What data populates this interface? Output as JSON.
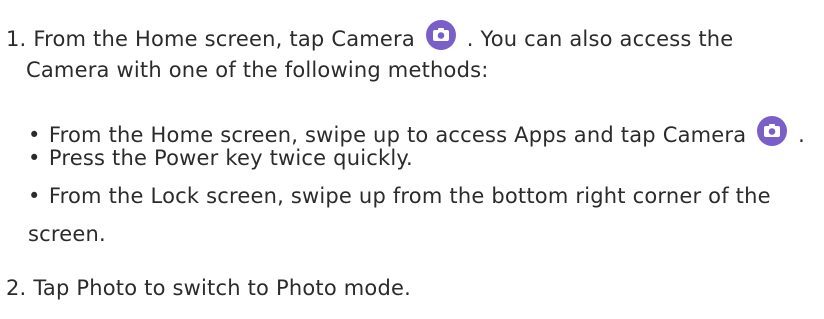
{
  "step1": {
    "number": "1.",
    "text_before_icon": "From the Home screen, tap Camera",
    "text_after_icon": ". You can also access the",
    "continuation": "Camera with one of the following methods:",
    "icon": "camera-app-icon"
  },
  "bullets": [
    {
      "marker": "•",
      "text_before_icon": "From the Home screen, swipe up to access Apps and tap Camera",
      "text_after_icon": ".",
      "icon": "camera-app-icon"
    },
    {
      "marker": "•",
      "text": "Press the Power key twice quickly."
    },
    {
      "marker": "•",
      "text": "From the Lock screen, swipe up from the bottom right corner of the",
      "continuation": "screen."
    }
  ],
  "step2": {
    "number": "2.",
    "text": "Tap Photo to switch to Photo mode."
  },
  "colors": {
    "icon_background": "#7a5fc9",
    "icon_foreground": "#ffffff",
    "text": "#2b2b2b"
  }
}
